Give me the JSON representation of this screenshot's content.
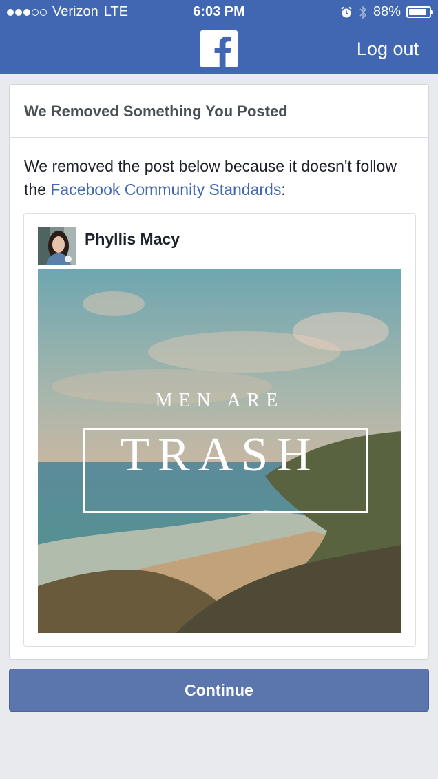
{
  "status_bar": {
    "carrier": "Verizon",
    "network": "LTE",
    "time": "6:03 PM",
    "battery": "88%",
    "battery_level": 0.88,
    "icons": [
      "signal-dots-icon",
      "alarm-icon",
      "bluetooth-icon",
      "battery-icon"
    ]
  },
  "nav": {
    "logo": "facebook-f-logo",
    "logout_label": "Log out",
    "brand_color": "#4267b2"
  },
  "dialog": {
    "title": "We Removed Something You Posted",
    "message_prefix": "We removed the post below because it doesn't follow the ",
    "message_link": "Facebook Community Standards",
    "message_suffix": ":"
  },
  "post": {
    "author": "Phyllis Macy",
    "image_text_top": "MEN ARE",
    "image_text_main": "TRASH"
  },
  "actions": {
    "continue_label": "Continue"
  }
}
